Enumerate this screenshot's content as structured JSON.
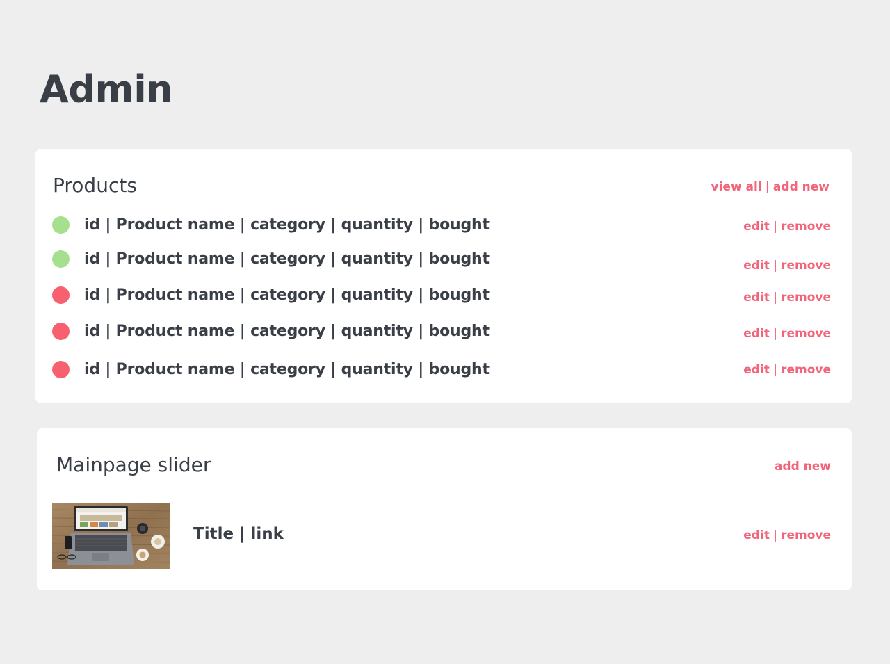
{
  "page": {
    "title": "Admin"
  },
  "products": {
    "title": "Products",
    "view_all_label": "view all",
    "separator": "|",
    "add_new_label": "add new",
    "rows": [
      {
        "text": "id | Product name | category | quantity | bought",
        "status": "active",
        "status_color": "#a6e08f",
        "edit_label": "edit",
        "remove_label": "remove"
      },
      {
        "text": "id | Product name | category | quantity | bought",
        "status": "active",
        "status_color": "#a6e08f",
        "edit_label": "edit",
        "remove_label": "remove"
      },
      {
        "text": "id | Product name | category | quantity | bought",
        "status": "inactive",
        "status_color": "#f7616f",
        "edit_label": "edit",
        "remove_label": "remove"
      },
      {
        "text": "id | Product name | category | quantity | bought",
        "status": "inactive",
        "status_color": "#f7616f",
        "edit_label": "edit",
        "remove_label": "remove"
      },
      {
        "text": "id | Product name | category | quantity | bought",
        "status": "inactive",
        "status_color": "#f7616f",
        "edit_label": "edit",
        "remove_label": "remove"
      }
    ]
  },
  "slider": {
    "title": "Mainpage slider",
    "add_new_label": "add new",
    "items": [
      {
        "text": "Title | link",
        "thumbnail_icon": "laptop-on-desk-photo",
        "edit_label": "edit",
        "separator": "|",
        "remove_label": "remove"
      }
    ]
  },
  "colors": {
    "background": "#eeeeee",
    "card": "#ffffff",
    "text": "#3a3f47",
    "accent": "#f26479",
    "status_active": "#a6e08f",
    "status_inactive": "#f7616f"
  }
}
